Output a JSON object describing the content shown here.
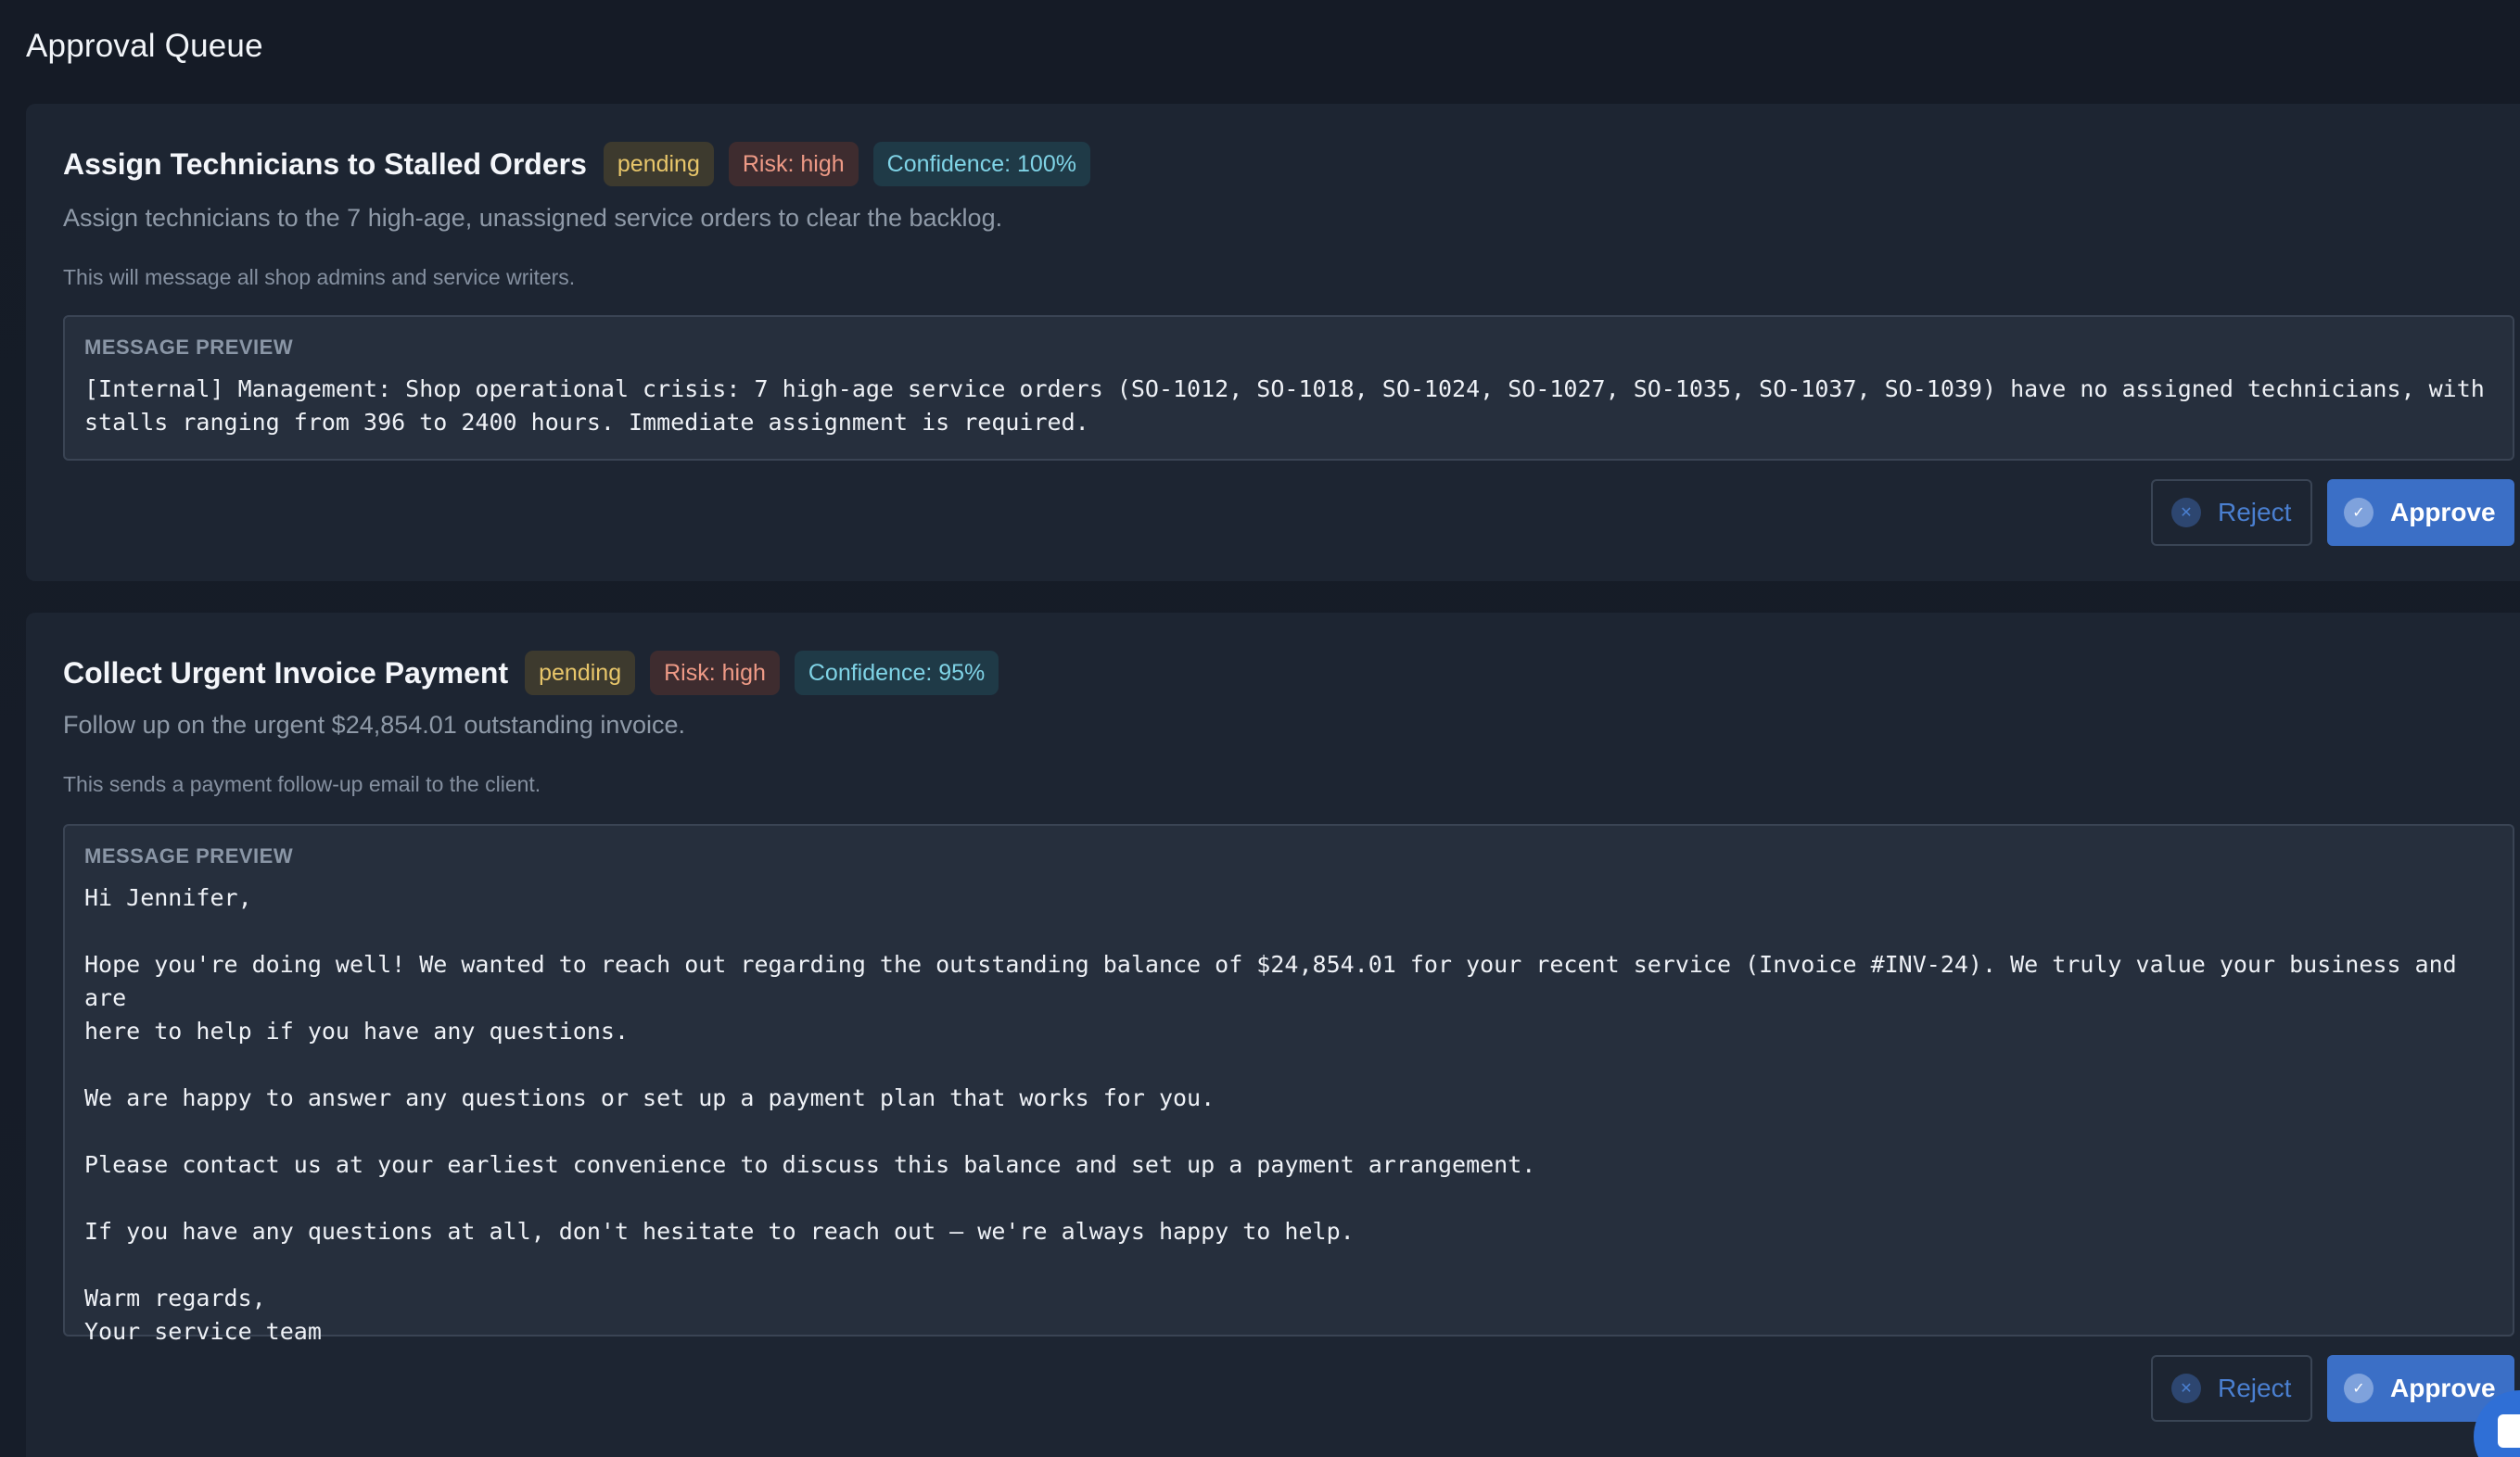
{
  "page": {
    "title": "Approval Queue"
  },
  "approvals": [
    {
      "title": "Assign Technicians to Stalled Orders",
      "status": "pending",
      "risk": "Risk: high",
      "confidence": "Confidence: 100%",
      "description": "Assign technicians to the 7 high-age, unassigned service orders to clear the backlog.",
      "note": "This will message all shop admins and service writers.",
      "preview_label": "MESSAGE PREVIEW",
      "preview_text": "[Internal] Management: Shop operational crisis: 7 high-age service orders (SO-1012, SO-1018, SO-1024, SO-1027, SO-1035, SO-1037, SO-1039) have no assigned technicians, with\nstalls ranging from 396 to 2400 hours. Immediate assignment is required.",
      "reject_label": "Reject",
      "approve_label": "Approve"
    },
    {
      "title": "Collect Urgent Invoice Payment",
      "status": "pending",
      "risk": "Risk: high",
      "confidence": "Confidence: 95%",
      "description": "Follow up on the urgent $24,854.01 outstanding invoice.",
      "note": "This sends a payment follow-up email to the client.",
      "preview_label": "MESSAGE PREVIEW",
      "preview_text": "Hi Jennifer,\n\nHope you're doing well! We wanted to reach out regarding the outstanding balance of $24,854.01 for your recent service (Invoice #INV-24). We truly value your business and are\nhere to help if you have any questions.\n\nWe are happy to answer any questions or set up a payment plan that works for you.\n\nPlease contact us at your earliest convenience to discuss this balance and set up a payment arrangement.\n\nIf you have any questions at all, don't hesitate to reach out — we're always happy to help.\n\nWarm regards,\nYour service team",
      "reject_label": "Reject",
      "approve_label": "Approve"
    }
  ],
  "icons": {
    "reject": "x-circle-icon",
    "approve": "check-circle-icon",
    "fab": "chat-icon"
  },
  "colors": {
    "background": "#151b26",
    "card": "#1d2532",
    "accent": "#3b6fc6",
    "pending": "#e8c66a",
    "risk": "#ee9a86",
    "confidence": "#7fd3e6"
  }
}
